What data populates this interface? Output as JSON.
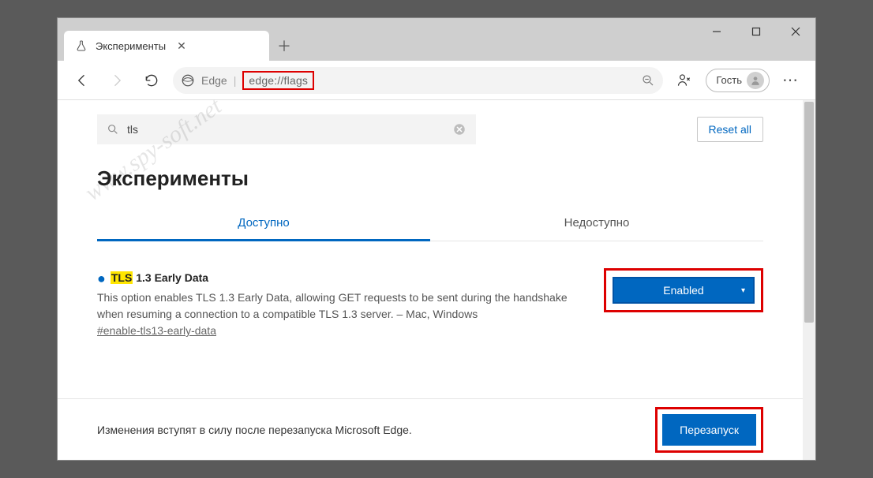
{
  "window": {
    "tab_title": "Эксперименты"
  },
  "address_bar": {
    "scheme_label": "Edge",
    "url": "edge://flags"
  },
  "profile": {
    "label": "Гость"
  },
  "page": {
    "search_value": "tls",
    "reset_label": "Reset all",
    "title": "Эксперименты",
    "tabs": {
      "available": "Доступно",
      "unavailable": "Недоступно"
    },
    "flag": {
      "highlight": "TLS",
      "title_rest": " 1.3 Early Data",
      "description": "This option enables TLS 1.3 Early Data, allowing GET requests to be sent during the handshake when resuming a connection to a compatible TLS 1.3 server. – Mac, Windows",
      "anchor": "#enable-tls13-early-data",
      "selected": "Enabled"
    },
    "footer_note": "Изменения вступят в силу после перезапуска Microsoft Edge.",
    "restart_label": "Перезапуск"
  },
  "watermark": "www.spy-soft.net"
}
